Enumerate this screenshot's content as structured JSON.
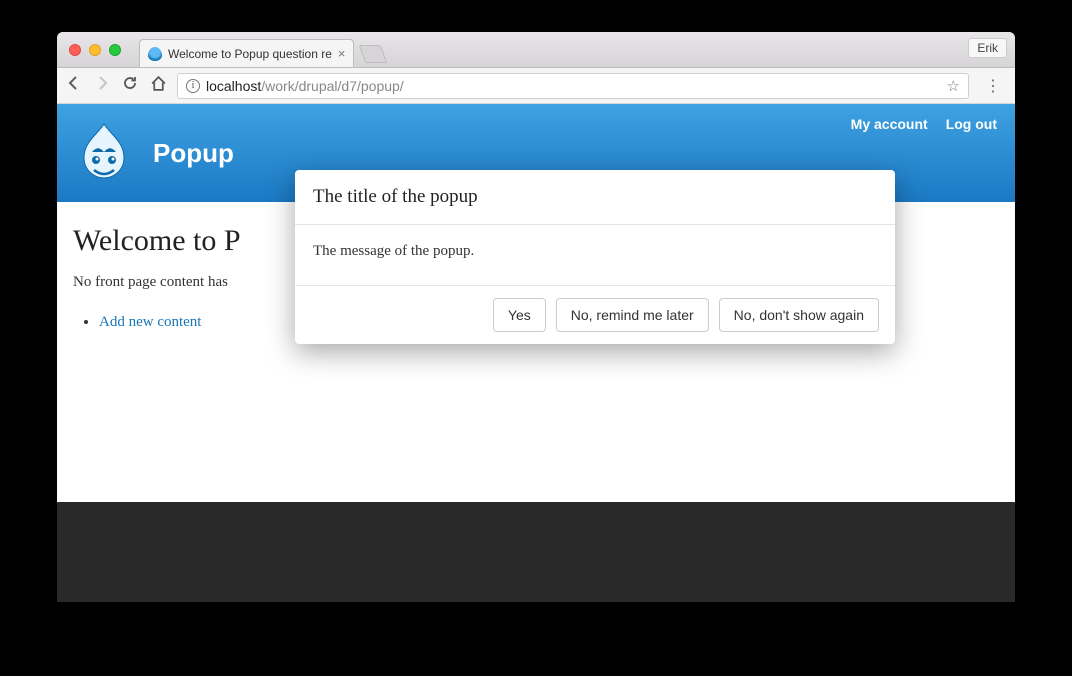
{
  "browser": {
    "tab_title": "Welcome to Popup question re",
    "user_label": "Erik",
    "url_host": "localhost",
    "url_path": "/work/drupal/d7/popup/"
  },
  "header": {
    "site_name": "Popup",
    "links": {
      "my_account": "My account",
      "log_out": "Log out"
    }
  },
  "page": {
    "title": "Welcome to P",
    "body_text": "No front page content has",
    "add_link": "Add new content"
  },
  "dialog": {
    "title": "The title of the popup",
    "message": "The message of the popup.",
    "buttons": {
      "yes": "Yes",
      "remind": "No, remind me later",
      "never": "No, don't show again"
    }
  }
}
